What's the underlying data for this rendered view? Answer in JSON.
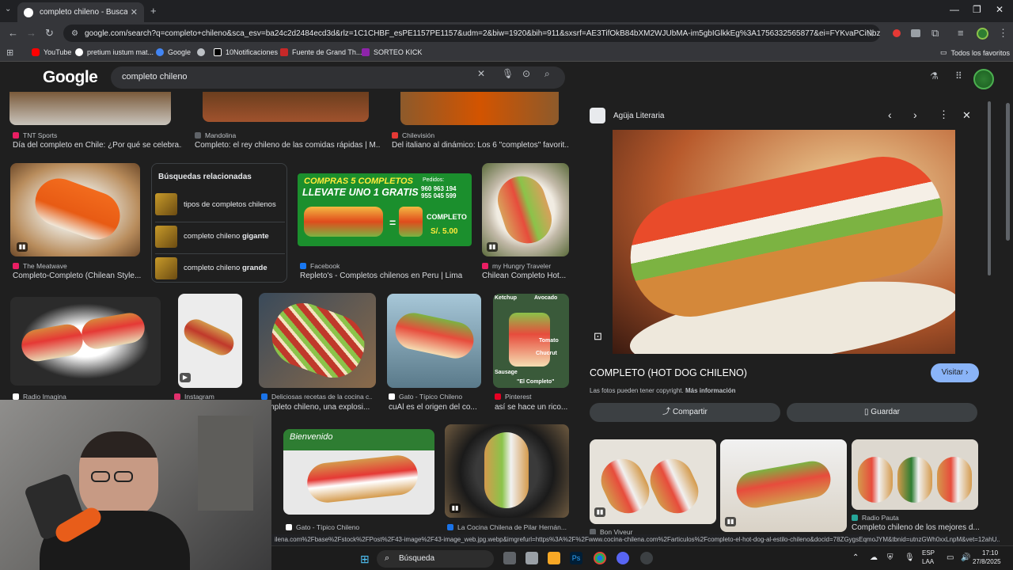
{
  "browser": {
    "tab_title": "completo chileno - Buscar con Google",
    "url": "google.com/search?q=completo+chileno&sca_esv=ba24c2d2484ecd3d&rlz=1C1CHBF_esPE1157PE1157&udm=2&biw=1920&bih=911&sxsrf=AE3TifOkB84bXM2WJUbMA-im5gbIGlkkEg%3A1756332565877&ei=FYKvaPCiNbzS5OUPqOf6...",
    "bookmarks": [
      {
        "label": "YouTube",
        "color": "#ff0000"
      },
      {
        "label": "pretium iustum mat...",
        "color": "#ffffff"
      },
      {
        "label": "Google",
        "color": "#4285f4"
      },
      {
        "label": "",
        "color": "#bdc1c6"
      },
      {
        "label": "10Notificaciones",
        "color": "#000000"
      },
      {
        "label": "Fuente de Grand Th...",
        "color": "#c62828"
      },
      {
        "label": "SORTEO KICK",
        "color": "#8e24aa"
      }
    ],
    "all_bookmarks": "Todos los favoritos"
  },
  "search": {
    "logo": "Google",
    "query": "completo chileno"
  },
  "results": {
    "row1": [
      {
        "source": "TNT Sports",
        "caption": "Día del completo en Chile: ¿Por qué se celebra...",
        "fav": "#e91e63"
      },
      {
        "source": "Mandolina",
        "caption": "Completo: el rey chileno de las comidas rápidas | M...",
        "fav": "#5f6368"
      },
      {
        "source": "Chilevisión",
        "caption": "Del italiano al dinámico: Los 6 \"completos\" favorit...",
        "fav": "#e53935"
      }
    ],
    "row2": [
      {
        "source": "The Meatwave",
        "caption": "Completo-Completo (Chilean Style...",
        "fav": "#e91e63"
      },
      {
        "source": "Facebook",
        "caption": "Repleto's - Completos chilenos en Peru | Lima",
        "fav": "#1877f2"
      },
      {
        "source": "my Hungry Traveler",
        "caption": "Chilean Completo Hot...",
        "fav": "#e91e63"
      }
    ],
    "related": {
      "heading": "Búsquedas relacionadas",
      "items": [
        {
          "label_prefix": "tipos de completos chilenos",
          "label_bold": ""
        },
        {
          "label_prefix": "completo chileno ",
          "label_bold": "gigante"
        },
        {
          "label_prefix": "completo chileno ",
          "label_bold": "grande"
        }
      ]
    },
    "ad": {
      "line1": "COMPRAS 5 COMPLETOS",
      "line2": "LLEVATE UNO 1 GRATIS",
      "pedidos": "Pedidos:",
      "phone1": "960 963 194",
      "phone2": "955 045 599",
      "combo": "COMPLETO",
      "price": "S/. 5.00"
    },
    "row3": [
      {
        "source": "Radio Imagina",
        "caption": "",
        "fav": "#ffffff"
      },
      {
        "source": "Instagram",
        "caption": "",
        "fav": "#e1306c"
      },
      {
        "source": "Deliciosas recetas de la cocina c...",
        "caption": "...mpleto chileno, una explosi...",
        "fav": "#1a73e8"
      },
      {
        "source": "Gato - Típico Chileno",
        "caption": "cuÁl es el origen del co...",
        "fav": "#ffffff"
      },
      {
        "source": "Pinterest",
        "caption": "así se hace un rico...",
        "fav": "#e60023"
      }
    ],
    "recipe_labels": {
      "ketchup": "Ketchup",
      "avocado": "Avocado",
      "tomato": "Tomato",
      "chucrut": "Chucrut",
      "sausage": "Sausage",
      "completo": "\"El Completo\""
    },
    "banner_text": "Bienvenido",
    "row4": [
      {
        "source": "Gato - Típico Chileno",
        "fav": "#ffffff"
      },
      {
        "source": "La Cocina Chilena de Pilar Hernán...",
        "fav": "#1a73e8"
      }
    ]
  },
  "panel": {
    "source": "Agüja Literaria",
    "title": "COMPLETO (HOT DOG CHILENO)",
    "visit": "Visitar",
    "copyright": "Las fotos pueden tener copyright.",
    "more_info": "Más información",
    "share": "Compartir",
    "save": "Guardar",
    "related": [
      {
        "source": "Bon Viveur",
        "caption": "",
        "fav": "#5f6368"
      },
      {
        "source": "",
        "caption": "",
        "fav": "#5f6368"
      },
      {
        "source": "Radio Pauta",
        "caption": "Completo chileno de los mejores d...",
        "fav": "#26a69a"
      }
    ]
  },
  "status_url": "ilena.com%2Fbase%2Fstock%2FPost%2F43-image%2F43-image_web.jpg.webp&imgrefurl=https%3A%2F%2Fwww.cocina-chilena.com%2Farticulos%2Fcompleto-el-hot-dog-al-estilo-chileno&docid=78ZGygsEqmoJYM&tbnid=utnzGWh0xxLnpM&vet=12ahU...",
  "taskbar": {
    "search": "Búsqueda",
    "lang1": "ESP",
    "lang2": "LAA",
    "time": "17:10",
    "date": "27/8/2025"
  },
  "colors": {
    "accent": "#8ab4f8",
    "background": "#1f1f1f"
  }
}
